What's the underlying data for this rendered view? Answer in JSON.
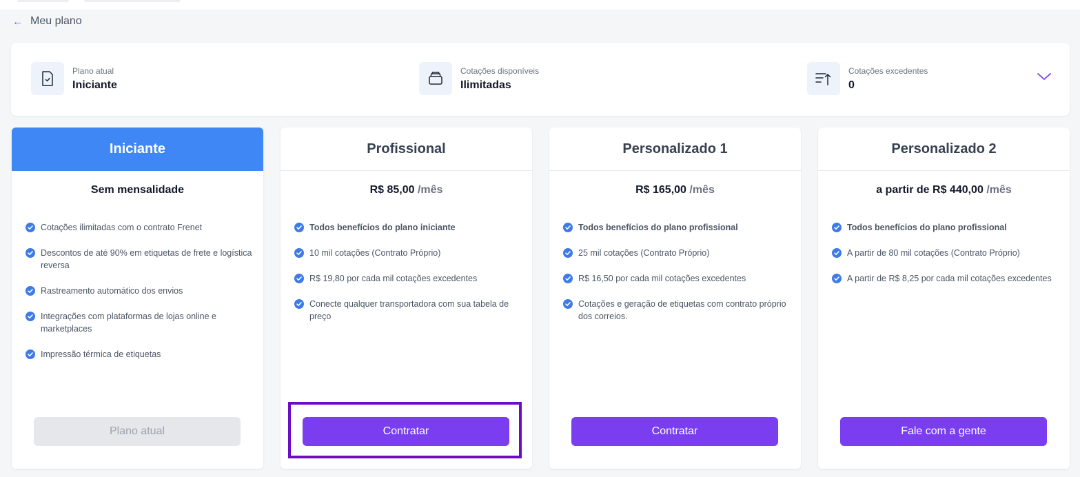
{
  "back_label": "Meu plano",
  "summary": {
    "items": [
      {
        "label": "Plano atual",
        "value": "Iniciante",
        "icon": "document-check-icon"
      },
      {
        "label": "Cotações disponíveis",
        "value": "Ilimitadas",
        "icon": "stack-icon"
      },
      {
        "label": "Cotações excedentes",
        "value": "0",
        "icon": "sort-up-icon"
      }
    ]
  },
  "plans": [
    {
      "name": "Iniciante",
      "price_prefix": "",
      "price": "Sem mensalidade",
      "per": "",
      "features": [
        {
          "text": "Cotações ilimitadas com o contrato Frenet",
          "bold": false
        },
        {
          "text": "Descontos de até 90% em etiquetas de frete e logística reversa",
          "bold": false
        },
        {
          "text": "Rastreamento automático dos envios",
          "bold": false
        },
        {
          "text": "Integrações com plataformas de lojas online e marketplaces",
          "bold": false
        },
        {
          "text": "Impressão térmica de etiquetas",
          "bold": false
        }
      ],
      "button": "Plano atual"
    },
    {
      "name": "Profissional",
      "price_prefix": "",
      "price": "R$ 85,00",
      "per": "/mês",
      "features": [
        {
          "text": "Todos benefícios do plano iniciante",
          "bold": true
        },
        {
          "text": "10 mil cotações (Contrato Próprio)",
          "bold": false
        },
        {
          "text": "R$ 19,80 por cada mil cotações excedentes",
          "bold": false
        },
        {
          "text": "Conecte qualquer transportadora com sua tabela de preço",
          "bold": false
        }
      ],
      "button": "Contratar"
    },
    {
      "name": "Personalizado 1",
      "price_prefix": "",
      "price": "R$ 165,00",
      "per": "/mês",
      "features": [
        {
          "text": "Todos benefícios do plano profissional",
          "bold": true
        },
        {
          "text": "25 mil cotações (Contrato Próprio)",
          "bold": false
        },
        {
          "text": "R$ 16,50 por cada mil cotações excedentes",
          "bold": false
        },
        {
          "text": "Cotações e geração de etiquetas com contrato próprio dos correios.",
          "bold": false
        }
      ],
      "button": "Contratar"
    },
    {
      "name": "Personalizado 2",
      "price_prefix": "a partir de ",
      "price": "R$ 440,00",
      "per": "/mês",
      "features": [
        {
          "text": "Todos benefícios do plano profissional",
          "bold": true
        },
        {
          "text": "A partir de 80 mil cotações (Contrato Próprio)",
          "bold": false
        },
        {
          "text": "A partir de R$ 8,25 por cada mil cotações excedentes",
          "bold": false
        }
      ],
      "button": "Fale com a gente"
    }
  ],
  "colors": {
    "accent": "#7a3ef0",
    "active_header": "#3f87f5",
    "check": "#3f7be8",
    "highlight": "#6a0dc7"
  }
}
